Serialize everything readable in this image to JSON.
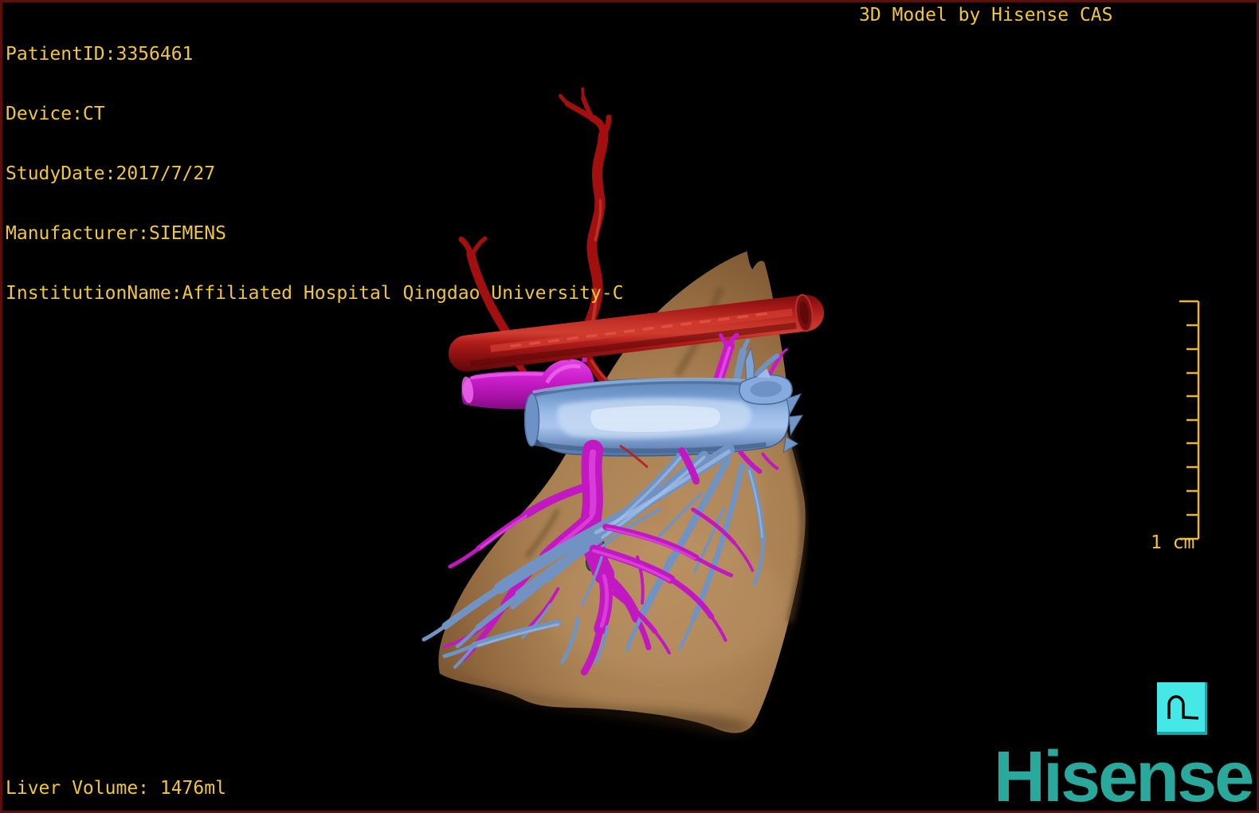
{
  "header": {
    "patient_info": [
      "PatientID:3356461",
      "Device:CT",
      "StudyDate:2017/7/27",
      "Manufacturer:SIEMENS",
      "InstitutionName:Affiliated Hospital Qingdao University-C"
    ],
    "app_title": "3D Model by Hisense CAS"
  },
  "footer": {
    "liver_volume": "Liver Volume: 1476ml",
    "brand": "Hisense"
  },
  "scale_bar": {
    "label": "1 cm",
    "intervals": 10
  },
  "viewport_style": {
    "background": "#000000",
    "border_color": "#5c0d0d",
    "overlay_text_color": "#f1c63b",
    "brand_color": "#2ba89c",
    "orientation_icon_color": "#45e8e6"
  },
  "model": {
    "description": "3D segmented liver model with vasculature",
    "structures": [
      {
        "name": "liver",
        "color": "#a88052"
      },
      {
        "name": "aorta",
        "color": "#a51212"
      },
      {
        "name": "hepatic-artery",
        "color": "#a20f0f"
      },
      {
        "name": "portal-vein",
        "color": "#cc1ecc"
      },
      {
        "name": "inferior-vena-cava",
        "color": "#7fa3d6"
      },
      {
        "name": "hepatic-veins",
        "color": "#7093c3"
      },
      {
        "name": "gallbladder",
        "color": "#117417"
      }
    ]
  }
}
